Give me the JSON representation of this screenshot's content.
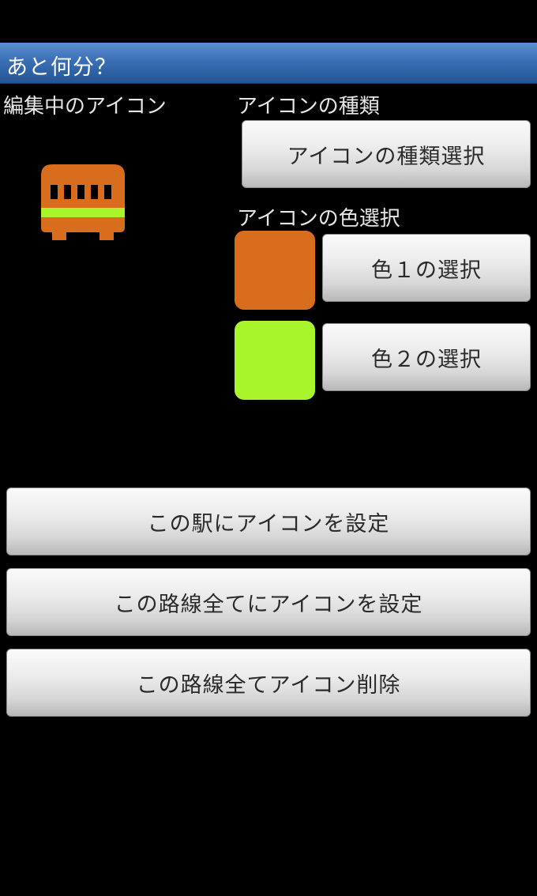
{
  "app": {
    "title": "あと何分？"
  },
  "left_panel": {
    "heading": "編集中のアイコン",
    "icon_name": "train-icon"
  },
  "type_section": {
    "heading": "アイコンの種類",
    "select_button": "アイコンの種類選択"
  },
  "color_section": {
    "heading": "アイコンの色選択",
    "color1": {
      "value": "#d96d1e",
      "button": "色１の選択"
    },
    "color2": {
      "value": "#a8f52c",
      "button": "色２の選択"
    }
  },
  "actions": {
    "set_station": "この駅にアイコンを設定",
    "set_all_line": "この路線全てにアイコンを設定",
    "delete_all_line": "この路線全てアイコン削除"
  }
}
